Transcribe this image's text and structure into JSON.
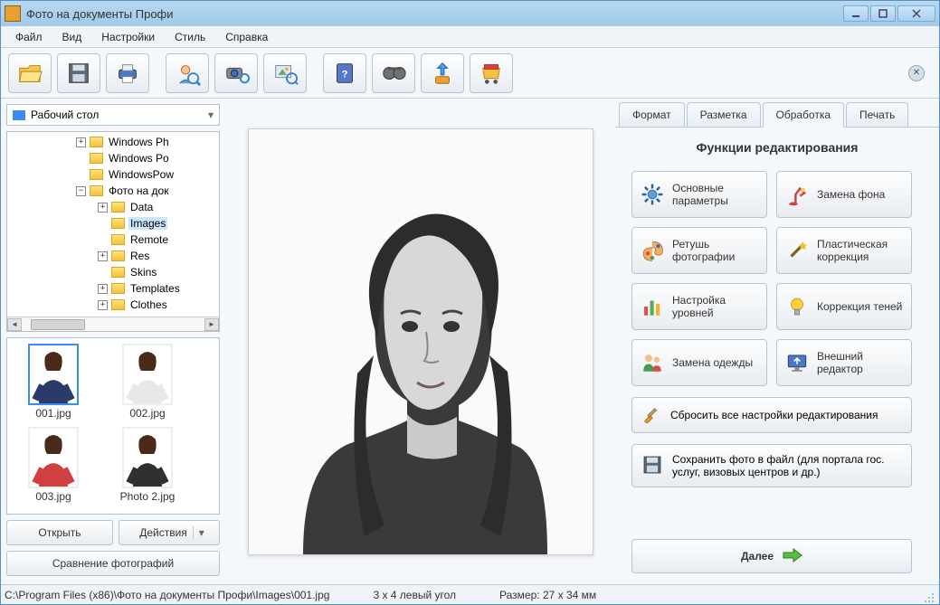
{
  "window": {
    "title": "Фото на документы Профи"
  },
  "menus": [
    "Файл",
    "Вид",
    "Настройки",
    "Стиль",
    "Справка"
  ],
  "folder_combo": {
    "label": "Рабочий стол"
  },
  "tree": {
    "items": [
      {
        "depth": 3,
        "expander": "+",
        "label": "Windows Ph"
      },
      {
        "depth": 3,
        "expander": "",
        "label": "Windows Po"
      },
      {
        "depth": 3,
        "expander": "",
        "label": "WindowsPow"
      },
      {
        "depth": 3,
        "expander": "−",
        "label": "Фото на док"
      },
      {
        "depth": 4,
        "expander": "+",
        "label": "Data"
      },
      {
        "depth": 4,
        "expander": "",
        "label": "Images",
        "selected": true
      },
      {
        "depth": 4,
        "expander": "",
        "label": "Remote"
      },
      {
        "depth": 4,
        "expander": "+",
        "label": "Res"
      },
      {
        "depth": 4,
        "expander": "",
        "label": "Skins"
      },
      {
        "depth": 4,
        "expander": "+",
        "label": "Templates"
      },
      {
        "depth": 4,
        "expander": "+",
        "label": "Clothes"
      }
    ]
  },
  "thumbnails": [
    {
      "label": "001.jpg",
      "selected": true
    },
    {
      "label": "002.jpg"
    },
    {
      "label": "003.jpg"
    },
    {
      "label": "Photo 2.jpg"
    }
  ],
  "left_buttons": {
    "open": "Открыть",
    "actions": "Действия",
    "compare": "Сравнение фотографий"
  },
  "tabs": {
    "items": [
      "Формат",
      "Разметка",
      "Обработка",
      "Печать"
    ],
    "active_index": 2
  },
  "panel_title": "Функции редактирования",
  "edit_buttons": [
    {
      "name": "basic-params",
      "label": "Основные параметры",
      "icon": "gear"
    },
    {
      "name": "replace-bg",
      "label": "Замена фона",
      "icon": "lamp"
    },
    {
      "name": "retouch",
      "label": "Ретушь фотографии",
      "icon": "palette"
    },
    {
      "name": "plastic",
      "label": "Пластическая коррекция",
      "icon": "wand"
    },
    {
      "name": "levels",
      "label": "Настройка уровней",
      "icon": "bars"
    },
    {
      "name": "shadow",
      "label": "Коррекция теней",
      "icon": "bulb"
    },
    {
      "name": "clothes",
      "label": "Замена одежды",
      "icon": "people"
    },
    {
      "name": "external",
      "label": "Внешний редактор",
      "icon": "monitor"
    }
  ],
  "reset_label": "Сбросить все настройки редактирования",
  "save_label": "Сохранить фото в файл (для портала гос. услуг, визовых центров и др.)",
  "next_label": "Далее",
  "status": {
    "path": "C:\\Program Files (x86)\\Фото на документы Профи\\Images\\001.jpg",
    "crop": "3 x 4 левый угол",
    "size": "Размер: 27 x 34 мм"
  }
}
